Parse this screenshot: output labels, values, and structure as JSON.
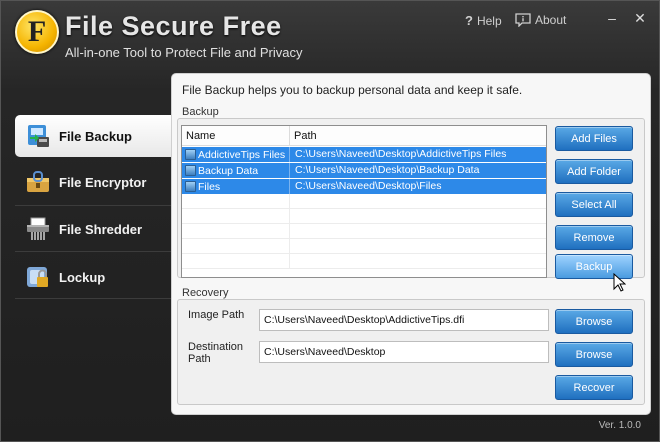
{
  "app": {
    "title": "File Secure Free",
    "subtitle": "All-in-one Tool to Protect File and Privacy",
    "logo_letter": "F",
    "version": "Ver. 1.0.0"
  },
  "topbar": {
    "help": "Help",
    "about": "About",
    "minimize": "–",
    "close": "✕"
  },
  "sidebar": {
    "items": [
      {
        "label": "File Backup",
        "icon": "backup-icon",
        "active": true
      },
      {
        "label": "File Encryptor",
        "icon": "encryptor-icon",
        "active": false
      },
      {
        "label": "File Shredder",
        "icon": "shredder-icon",
        "active": false
      },
      {
        "label": "Lockup",
        "icon": "lock-icon",
        "active": false
      }
    ]
  },
  "main": {
    "description": "File Backup helps you to backup personal data and keep it safe.",
    "backup": {
      "section_label": "Backup",
      "columns": [
        "Name",
        "Path"
      ],
      "rows": [
        {
          "name": "AddictiveTips Files",
          "path": "C:\\Users\\Naveed\\Desktop\\AddictiveTips Files"
        },
        {
          "name": "Backup Data",
          "path": "C:\\Users\\Naveed\\Desktop\\Backup Data"
        },
        {
          "name": "Files",
          "path": "C:\\Users\\Naveed\\Desktop\\Files"
        }
      ],
      "buttons": {
        "add_files": "Add Files",
        "add_folder": "Add Folder",
        "select_all": "Select All",
        "remove": "Remove",
        "backup": "Backup"
      }
    },
    "recovery": {
      "section_label": "Recovery",
      "image_path_label": "Image Path",
      "image_path_value": "C:\\Users\\Naveed\\Desktop\\AddictiveTips.dfi",
      "destination_label": "Destination Path",
      "destination_label_line1": "Destination",
      "destination_label_line2": "Path",
      "destination_value": "C:\\Users\\Naveed\\Desktop",
      "browse": "Browse",
      "recover": "Recover"
    }
  },
  "colors": {
    "accent": "#2d89e8",
    "button": "#1f6fbf",
    "background": "#262626",
    "panel": "#f7f7f7"
  }
}
